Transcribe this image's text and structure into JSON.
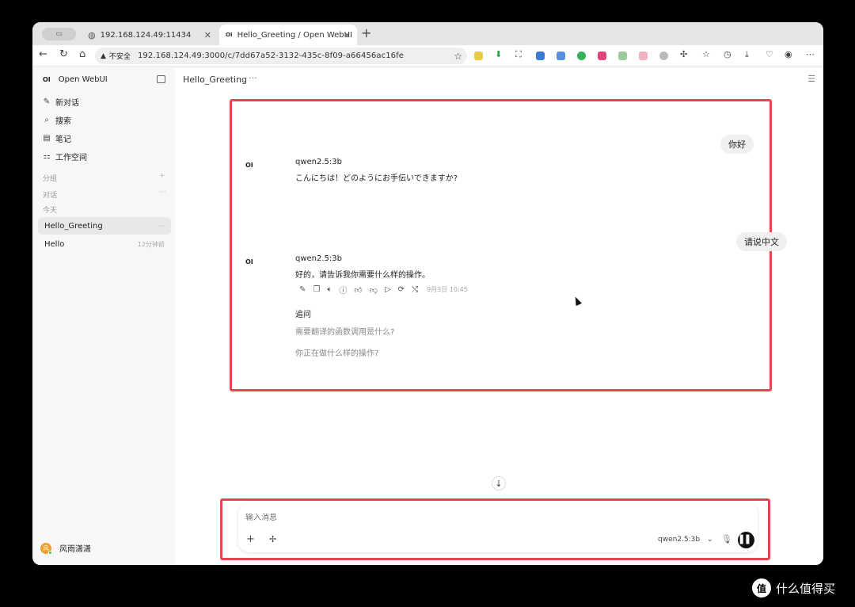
{
  "browser": {
    "tab_group_label": "",
    "tabs": [
      {
        "title": "192.168.124.49:11434",
        "icon": "globe-icon"
      },
      {
        "title": "Hello_Greeting / Open WebUI",
        "icon": "openwebui-icon",
        "active": true
      }
    ],
    "security_label": "不安全",
    "url": "192.168.124.49:3000/c/7dd67a52-3132-435c-8f09-a66456ac16fe"
  },
  "sidebar": {
    "brand_logo": "OI",
    "brand_name": "Open WebUI",
    "items": [
      {
        "icon": "✎",
        "label": "新对话"
      },
      {
        "icon": "⌕",
        "label": "搜索"
      },
      {
        "icon": "▤",
        "label": "笔记"
      },
      {
        "icon": "⚏",
        "label": "工作空间"
      }
    ],
    "sections": {
      "groups": "分组",
      "groups_action": "+",
      "chats": "对话",
      "chats_action": "···",
      "today": "今天"
    },
    "chats": [
      {
        "title": "Hello_Greeting",
        "meta": "···",
        "active": true
      },
      {
        "title": "Hello",
        "meta": "12分钟前",
        "active": false
      }
    ],
    "user": {
      "name": "风雨潇潇",
      "avatar_letter": "风"
    }
  },
  "chat": {
    "title": "Hello_Greeting",
    "title_more": "···",
    "messages": [
      {
        "role": "user",
        "text": "你好"
      },
      {
        "role": "assistant",
        "model": "qwen2.5:3b",
        "logo": "OI",
        "text": "こんにちは！どのようにお手伝いできますか?"
      },
      {
        "role": "user",
        "text": "请说中文"
      },
      {
        "role": "assistant",
        "model": "qwen2.5:3b",
        "logo": "OI",
        "text": "好的，请告诉我你需要什么样的操作。",
        "timestamp": "9月3日 10:45"
      }
    ],
    "followups_label": "追问",
    "followups": [
      "需要翻译的函数调用是什么?",
      "你正在做什么样的操作?"
    ]
  },
  "composer": {
    "placeholder": "输入消息",
    "model": "qwen2.5:3b"
  },
  "watermark": {
    "logo": "值",
    "text": "什么值得买"
  },
  "colors": {
    "highlight": "#e8474f",
    "accent_dark": "#111111"
  }
}
